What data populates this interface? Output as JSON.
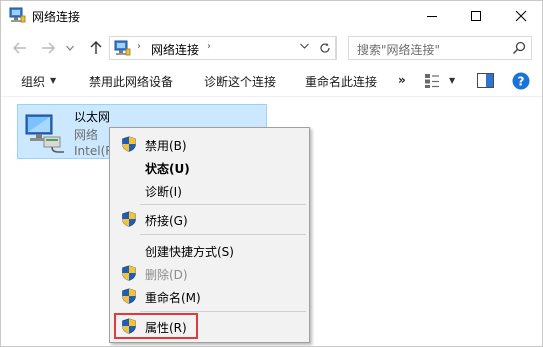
{
  "window": {
    "title": "网络连接"
  },
  "address": {
    "crumb": "网络连接",
    "search_placeholder": "搜索\"网络连接\""
  },
  "toolbar": {
    "organize": "组织",
    "disable_device": "禁用此网络设备",
    "diagnose": "诊断这个连接",
    "rename": "重命名此连接",
    "more": "»"
  },
  "adapter": {
    "name": "以太网",
    "network": "网络",
    "device": "Intel(R"
  },
  "context_menu": {
    "items": [
      {
        "label": "禁用(B)",
        "icon": "uac-shield-icon"
      },
      {
        "label": "状态(U)",
        "bold": true
      },
      {
        "label": "诊断(I)"
      },
      {
        "label": "桥接(G)",
        "icon": "uac-shield-icon"
      },
      {
        "label": "创建快捷方式(S)"
      },
      {
        "label": "删除(D)",
        "icon": "uac-shield-icon",
        "disabled": true
      },
      {
        "label": "重命名(M)",
        "icon": "uac-shield-icon"
      },
      {
        "label": "属性(R)",
        "icon": "uac-shield-icon",
        "highlighted": true
      }
    ]
  },
  "colors": {
    "selection": "#cce8ff",
    "highlight_box": "#e03a3a",
    "help": "#1a73d9"
  }
}
